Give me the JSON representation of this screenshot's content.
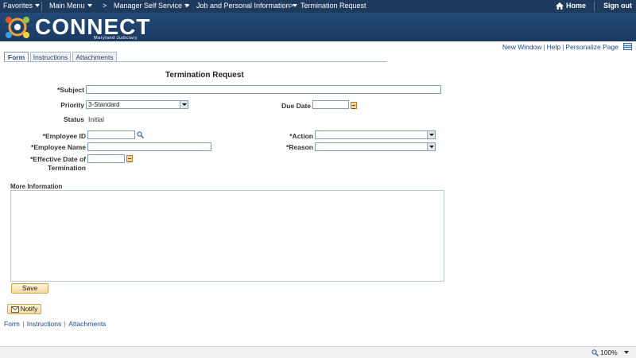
{
  "topnav": {
    "favorites": "Favorites",
    "main_menu": "Main Menu",
    "crumbs": [
      {
        "label": "Manager Self Service"
      },
      {
        "label": "Job and Personal Information"
      },
      {
        "label": "Termination Request"
      }
    ],
    "home": "Home",
    "sign_out": "Sign out"
  },
  "brand": {
    "name": "CONNECT",
    "subtitle": "Maryland Judiciary"
  },
  "page_links": {
    "new_window": "New Window",
    "help": "Help",
    "personalize": "Personalize Page"
  },
  "tabs": [
    {
      "label": "Form",
      "active": true
    },
    {
      "label": "Instructions",
      "active": false
    },
    {
      "label": "Attachments",
      "active": false
    }
  ],
  "form": {
    "title": "Termination Request",
    "subject_label": "*Subject",
    "subject_value": "",
    "priority_label": "Priority",
    "priority_value": "3-Standard",
    "due_date_label": "Due Date",
    "due_date_value": "",
    "status_label": "Status",
    "status_value": "Initial",
    "employee_id_label": "*Employee ID",
    "employee_id_value": "",
    "employee_name_label": "*Employee Name",
    "employee_name_value": "",
    "effective_date_label_line1": "*Effective Date of",
    "effective_date_label_line2": "Termination",
    "effective_date_value": "",
    "action_label": "*Action",
    "action_value": "",
    "reason_label": "*Reason",
    "reason_value": "",
    "more_info_label": "More Information",
    "more_info_value": "",
    "save_label": "Save",
    "notify_label": "Notify"
  },
  "bottom_links": {
    "form": "Form",
    "instructions": "Instructions",
    "attachments": "Attachments"
  },
  "statusbar": {
    "zoom": "100%"
  }
}
